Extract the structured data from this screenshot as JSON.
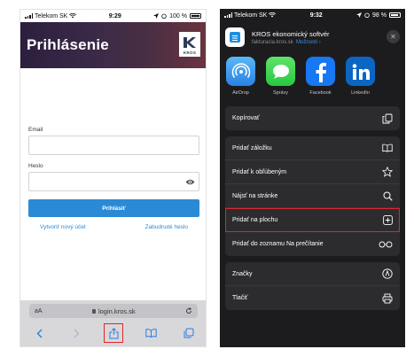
{
  "left_phone": {
    "status": {
      "carrier": "Telekom SK",
      "time": "9:29",
      "battery": "100 %"
    },
    "header": {
      "title": "Prihlásenie",
      "logo_text": "KROS"
    },
    "form": {
      "email_label": "Email",
      "email_value": "",
      "password_label": "Heslo",
      "password_value": "",
      "login_button": "Prihlásiť",
      "create_account_link": "Vytvoriť nový účet",
      "forgot_password_link": "Zabudnuté heslo"
    },
    "safari": {
      "text_size": "aA",
      "url": "login.kros.sk"
    }
  },
  "right_phone": {
    "status": {
      "carrier": "Telekom SK",
      "time": "9:32",
      "battery": "98 %"
    },
    "share_header": {
      "title": "KROS ekonomický softvér",
      "domain": "fakturacia.kros.sk",
      "options": "Možnosti ›"
    },
    "apps": [
      {
        "label": "AirDrop",
        "icon": "airdrop-icon"
      },
      {
        "label": "Správy",
        "icon": "messages-icon"
      },
      {
        "label": "Facebook",
        "icon": "facebook-icon"
      },
      {
        "label": "LinkedIn",
        "icon": "linkedin-icon"
      }
    ],
    "groups": [
      [
        {
          "label": "Kopírovať",
          "icon": "copy-icon"
        }
      ],
      [
        {
          "label": "Pridať záložku",
          "icon": "bookmark-icon"
        },
        {
          "label": "Pridať k obľúbeným",
          "icon": "star-icon"
        },
        {
          "label": "Nájsť na stránke",
          "icon": "search-icon"
        },
        {
          "label": "Pridať na plochu",
          "icon": "add-square-icon",
          "highlighted": true
        },
        {
          "label": "Pridať do zoznamu Na prečítanie",
          "icon": "glasses-icon"
        }
      ],
      [
        {
          "label": "Značky",
          "icon": "markup-icon"
        },
        {
          "label": "Tlačiť",
          "icon": "print-icon"
        }
      ]
    ]
  },
  "colors": {
    "primary_blue": "#2a8ad6",
    "highlight_red": "#e0242b",
    "share_sheet_bg": "#1c1c1e"
  }
}
